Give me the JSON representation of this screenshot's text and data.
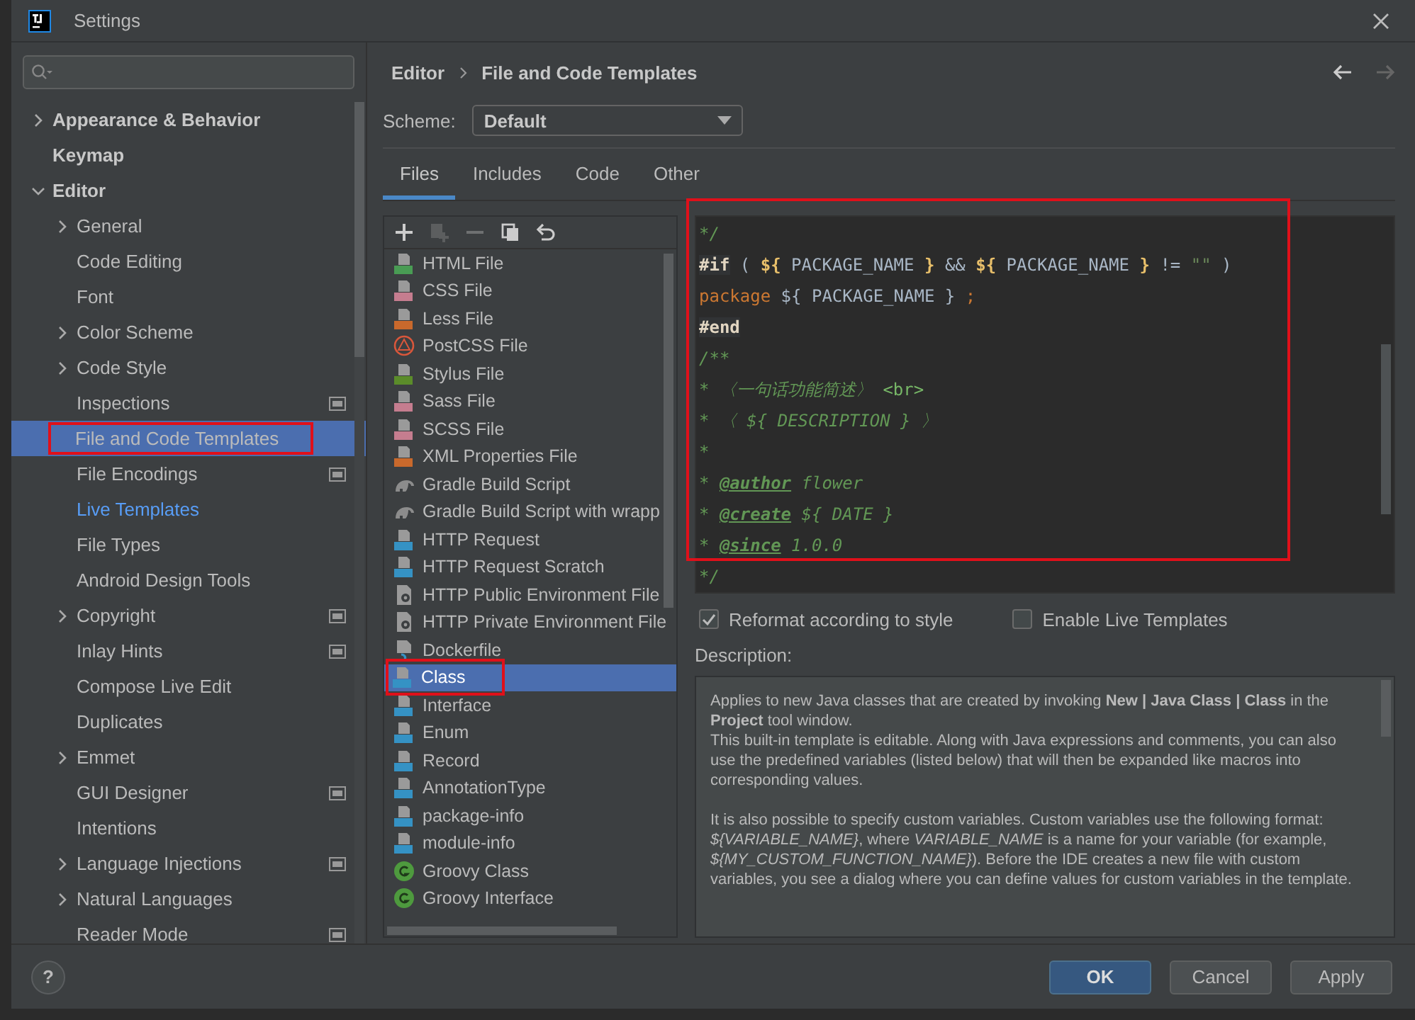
{
  "window": {
    "title": "Settings"
  },
  "sidebar": {
    "items": [
      {
        "label": "Appearance & Behavior",
        "expanded": false,
        "selected": false,
        "modified": false,
        "project_level": false,
        "boxed": false
      },
      {
        "label": "Keymap",
        "selected": false,
        "modified": false,
        "project_level": false,
        "boxed": false
      },
      {
        "label": "Editor",
        "expanded": true,
        "selected": false,
        "modified": false,
        "project_level": false,
        "boxed": false,
        "children": [
          {
            "label": "General",
            "expanded": false,
            "selected": false,
            "modified": false,
            "project_level": false,
            "boxed": false
          },
          {
            "label": "Code Editing",
            "selected": false,
            "modified": false,
            "project_level": false,
            "boxed": false
          },
          {
            "label": "Font",
            "selected": false,
            "modified": false,
            "project_level": false,
            "boxed": false
          },
          {
            "label": "Color Scheme",
            "expanded": false,
            "selected": false,
            "modified": false,
            "project_level": false,
            "boxed": false
          },
          {
            "label": "Code Style",
            "expanded": false,
            "selected": false,
            "modified": false,
            "project_level": false,
            "boxed": false
          },
          {
            "label": "Inspections",
            "selected": false,
            "modified": false,
            "project_level": true,
            "boxed": false
          },
          {
            "label": "File and Code Templates",
            "selected": true,
            "modified": false,
            "project_level": false,
            "boxed": true
          },
          {
            "label": "File Encodings",
            "selected": false,
            "modified": false,
            "project_level": true,
            "boxed": false
          },
          {
            "label": "Live Templates",
            "selected": false,
            "modified": true,
            "project_level": false,
            "boxed": false
          },
          {
            "label": "File Types",
            "selected": false,
            "modified": false,
            "project_level": false,
            "boxed": false
          },
          {
            "label": "Android Design Tools",
            "selected": false,
            "modified": false,
            "project_level": false,
            "boxed": false
          },
          {
            "label": "Copyright",
            "expanded": false,
            "selected": false,
            "modified": false,
            "project_level": true,
            "boxed": false
          },
          {
            "label": "Inlay Hints",
            "selected": false,
            "modified": false,
            "project_level": true,
            "boxed": false
          },
          {
            "label": "Compose Live Edit",
            "selected": false,
            "modified": false,
            "project_level": false,
            "boxed": false
          },
          {
            "label": "Duplicates",
            "selected": false,
            "modified": false,
            "project_level": false,
            "boxed": false
          },
          {
            "label": "Emmet",
            "expanded": false,
            "selected": false,
            "modified": false,
            "project_level": false,
            "boxed": false
          },
          {
            "label": "GUI Designer",
            "selected": false,
            "modified": false,
            "project_level": true,
            "boxed": false
          },
          {
            "label": "Intentions",
            "selected": false,
            "modified": false,
            "project_level": false,
            "boxed": false
          },
          {
            "label": "Language Injections",
            "expanded": false,
            "selected": false,
            "modified": false,
            "project_level": true,
            "boxed": false
          },
          {
            "label": "Natural Languages",
            "expanded": false,
            "selected": false,
            "modified": false,
            "project_level": false,
            "boxed": false
          },
          {
            "label": "Reader Mode",
            "selected": false,
            "modified": false,
            "project_level": true,
            "boxed": false
          }
        ]
      }
    ]
  },
  "breadcrumb": [
    "Editor",
    "File and Code Templates"
  ],
  "nav": {
    "back_enabled": true,
    "forward_enabled": false
  },
  "scheme": {
    "label": "Scheme:",
    "value": "Default"
  },
  "tabs": [
    {
      "label": "Files",
      "selected": true
    },
    {
      "label": "Includes",
      "selected": false
    },
    {
      "label": "Code",
      "selected": false
    },
    {
      "label": "Other",
      "selected": false
    }
  ],
  "toolbar": [
    {
      "kind": "add",
      "disabled": false
    },
    {
      "kind": "copy-add",
      "disabled": true
    },
    {
      "kind": "remove",
      "disabled": true
    },
    {
      "kind": "copy",
      "disabled": false
    },
    {
      "kind": "reset",
      "disabled": false
    }
  ],
  "templates": [
    {
      "label": "HTML File",
      "kind": "html",
      "selected": false,
      "boxed": false
    },
    {
      "label": "CSS File",
      "kind": "css",
      "selected": false,
      "boxed": false
    },
    {
      "label": "Less File",
      "kind": "less",
      "selected": false,
      "boxed": false
    },
    {
      "label": "PostCSS File",
      "kind": "postcss",
      "selected": false,
      "boxed": false
    },
    {
      "label": "Stylus File",
      "kind": "stylus",
      "selected": false,
      "boxed": false
    },
    {
      "label": "Sass File",
      "kind": "sass",
      "selected": false,
      "boxed": false
    },
    {
      "label": "SCSS File",
      "kind": "sass",
      "selected": false,
      "boxed": false
    },
    {
      "label": "XML Properties File",
      "kind": "xml",
      "selected": false,
      "boxed": false
    },
    {
      "label": "Gradle Build Script",
      "kind": "gradle",
      "selected": false,
      "boxed": false
    },
    {
      "label": "Gradle Build Script with wrapp",
      "kind": "gradle",
      "selected": false,
      "boxed": false
    },
    {
      "label": "HTTP Request",
      "kind": "http",
      "selected": false,
      "boxed": false
    },
    {
      "label": "HTTP Request Scratch",
      "kind": "http",
      "selected": false,
      "boxed": false
    },
    {
      "label": "HTTP Public Environment File",
      "kind": "env",
      "selected": false,
      "boxed": false
    },
    {
      "label": "HTTP Private Environment File",
      "kind": "env",
      "selected": false,
      "boxed": false
    },
    {
      "label": "Dockerfile",
      "kind": "docker",
      "selected": false,
      "boxed": false
    },
    {
      "label": "Class",
      "kind": "java",
      "selected": true,
      "boxed": true
    },
    {
      "label": "Interface",
      "kind": "java",
      "selected": false,
      "boxed": false
    },
    {
      "label": "Enum",
      "kind": "java",
      "selected": false,
      "boxed": false
    },
    {
      "label": "Record",
      "kind": "java",
      "selected": false,
      "boxed": false
    },
    {
      "label": "AnnotationType",
      "kind": "java",
      "selected": false,
      "boxed": false
    },
    {
      "label": "package-info",
      "kind": "java",
      "selected": false,
      "boxed": false
    },
    {
      "label": "module-info",
      "kind": "java",
      "selected": false,
      "boxed": false
    },
    {
      "label": "Groovy Class",
      "kind": "groovy",
      "selected": false,
      "boxed": false
    },
    {
      "label": "Groovy Interface",
      "kind": "groovy",
      "selected": false,
      "boxed": false
    }
  ],
  "editor": {
    "boxed": true,
    "lines": [
      [
        {
          "text": "*/",
          "kind": "comment"
        }
      ],
      [
        {
          "text": "#if",
          "kind": "directive"
        },
        {
          "text": " ( ",
          "kind": "plain"
        },
        {
          "text": "${",
          "kind": "var"
        },
        {
          "text": " PACKAGE_NAME ",
          "kind": "plain"
        },
        {
          "text": "}",
          "kind": "var"
        },
        {
          "text": " && ",
          "kind": "plain"
        },
        {
          "text": "${",
          "kind": "var"
        },
        {
          "text": " PACKAGE_NAME ",
          "kind": "plain"
        },
        {
          "text": "}",
          "kind": "var"
        },
        {
          "text": " != ",
          "kind": "plain"
        },
        {
          "text": "\"\"",
          "kind": "string"
        },
        {
          "text": " )",
          "kind": "plain"
        }
      ],
      [
        {
          "text": "package",
          "kind": "keyword"
        },
        {
          "text": " ${ PACKAGE_NAME } ",
          "kind": "plain"
        },
        {
          "text": ";",
          "kind": "keyword"
        }
      ],
      [
        {
          "text": "#end",
          "kind": "directive"
        }
      ],
      [
        {
          "text": "/**",
          "kind": "comment"
        }
      ],
      [
        {
          "text": "* 〈一句话功能简述〉 ",
          "kind": "comment"
        },
        {
          "text": "<br>",
          "kind": "tag"
        }
      ],
      [
        {
          "text": "* 〈 ${ DESCRIPTION } 〉",
          "kind": "comment"
        }
      ],
      [
        {
          "text": "*",
          "kind": "comment"
        }
      ],
      [
        {
          "text": "* ",
          "kind": "comment"
        },
        {
          "text": "@author",
          "kind": "doctag"
        },
        {
          "text": " flower",
          "kind": "comment"
        }
      ],
      [
        {
          "text": "* ",
          "kind": "comment"
        },
        {
          "text": "@create",
          "kind": "doctag"
        },
        {
          "text": " ${ DATE }",
          "kind": "comment"
        }
      ],
      [
        {
          "text": "* ",
          "kind": "comment"
        },
        {
          "text": "@since",
          "kind": "doctag"
        },
        {
          "text": " 1.0.0",
          "kind": "comment"
        }
      ],
      [
        {
          "text": "*/",
          "kind": "comment"
        }
      ]
    ]
  },
  "options": [
    {
      "label": "Reformat according to style",
      "checked": true
    },
    {
      "label": "Enable Live Templates",
      "checked": false
    }
  ],
  "description": {
    "label": "Description:",
    "blocks": [
      [
        "Applies to new Java classes that are created by invoking **New | Java Class | Class** in the **Project** tool window.",
        "This built-in template is editable. Along with Java expressions and comments, you can also use the predefined variables (listed below) that will then be expanded like macros into corresponding values."
      ],
      [
        "It is also possible to specify custom variables. Custom variables use the following format: *${VARIABLE_NAME}*, where *VARIABLE_NAME* is a name for your variable (for example, *${MY_CUSTOM_FUNCTION_NAME}*). Before the IDE creates a new file with custom variables, you see a dialog where you can define values for custom variables in the template."
      ]
    ]
  },
  "help": {
    "label": "?"
  },
  "buttons": [
    {
      "label": "OK",
      "default": true
    },
    {
      "label": "Cancel",
      "default": false
    },
    {
      "label": "Apply",
      "default": false
    }
  ]
}
